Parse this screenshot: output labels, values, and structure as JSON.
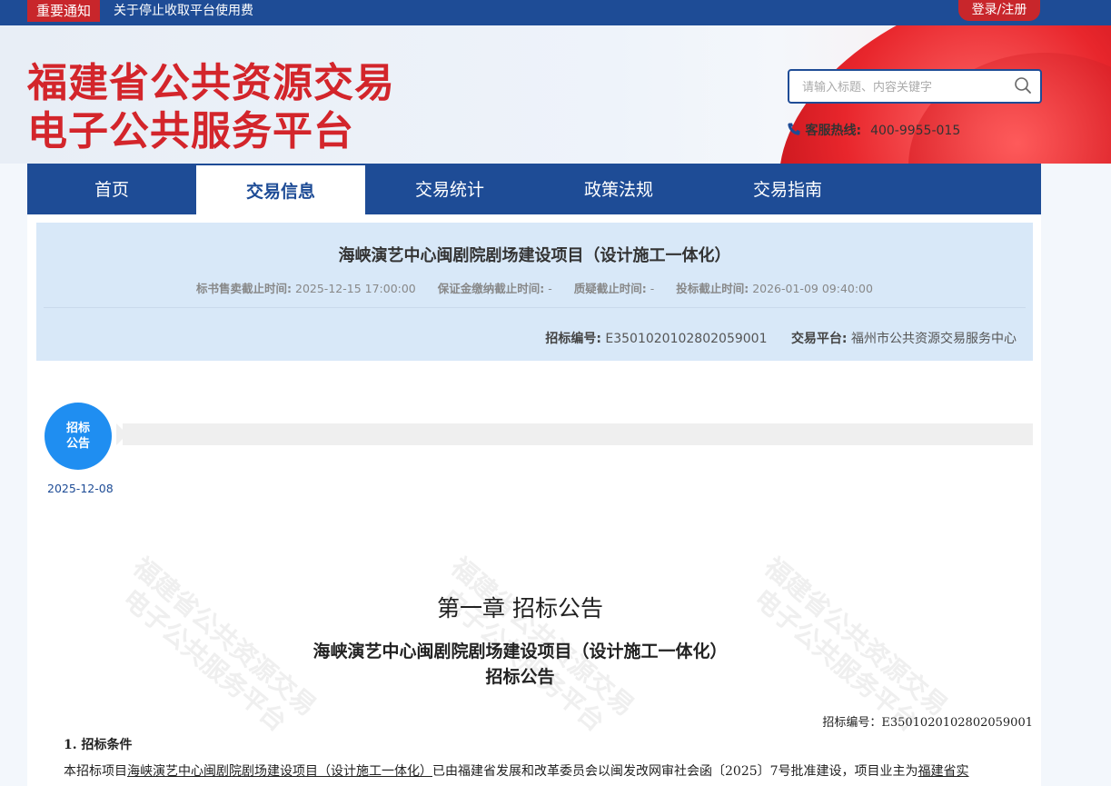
{
  "topbar": {
    "notice_tag": "重要通知",
    "notice_text": "关于停止收取平台使用费",
    "login": "登录/注册"
  },
  "header": {
    "logo_line1": "福建省公共资源交易",
    "logo_line2": "电子公共服务平台",
    "search_placeholder": "请输入标题、内容关键字",
    "hotline_label": "客服热线:",
    "hotline_number": "400-9955-015"
  },
  "nav": {
    "items": [
      "首页",
      "交易信息",
      "交易统计",
      "政策法规",
      "交易指南"
    ],
    "active_index": 1
  },
  "project": {
    "title": "海峡演艺中心闽剧院剧场建设项目（设计施工一体化）",
    "meta": [
      {
        "label": "标书售卖截止时间:",
        "value": "2025-12-15 17:00:00"
      },
      {
        "label": "保证金缴纳截止时间:",
        "value": "-"
      },
      {
        "label": "质疑截止时间:",
        "value": "-"
      },
      {
        "label": "投标截止时间:",
        "value": "2026-01-09 09:40:00"
      }
    ],
    "code_label": "招标编号:",
    "code_value": "E3501020102802059001",
    "platform_label": "交易平台:",
    "platform_value": "福州市公共资源交易服务中心"
  },
  "timeline": {
    "badge_line1": "招标",
    "badge_line2": "公告",
    "date": "2025-12-08"
  },
  "watermark": {
    "line1": "福建省公共资源交易",
    "line2": "电子公共服务平台"
  },
  "document": {
    "chapter": "第一章  招标公告",
    "title": "海峡演艺中心闽剧院剧场建设项目（设计施工一体化）",
    "subtitle": "招标公告",
    "code": "招标编号：E3501020102802059001",
    "section1": "1.  招标条件",
    "body_prefix": "本招标项目",
    "body_project": "海峡演艺中心闽剧院剧场建设项目（设计施工一体化）",
    "body_middle": "已由福建省发展和改革委员会以闽发改网审社会函〔2025〕7号批准建设，项目业主为",
    "body_owner": "福建省实"
  },
  "colors": {
    "brand_blue": "#1e4c96",
    "brand_red": "#d3252b",
    "card_bg": "#d8e8f8",
    "badge_blue": "#1f8ef1"
  }
}
